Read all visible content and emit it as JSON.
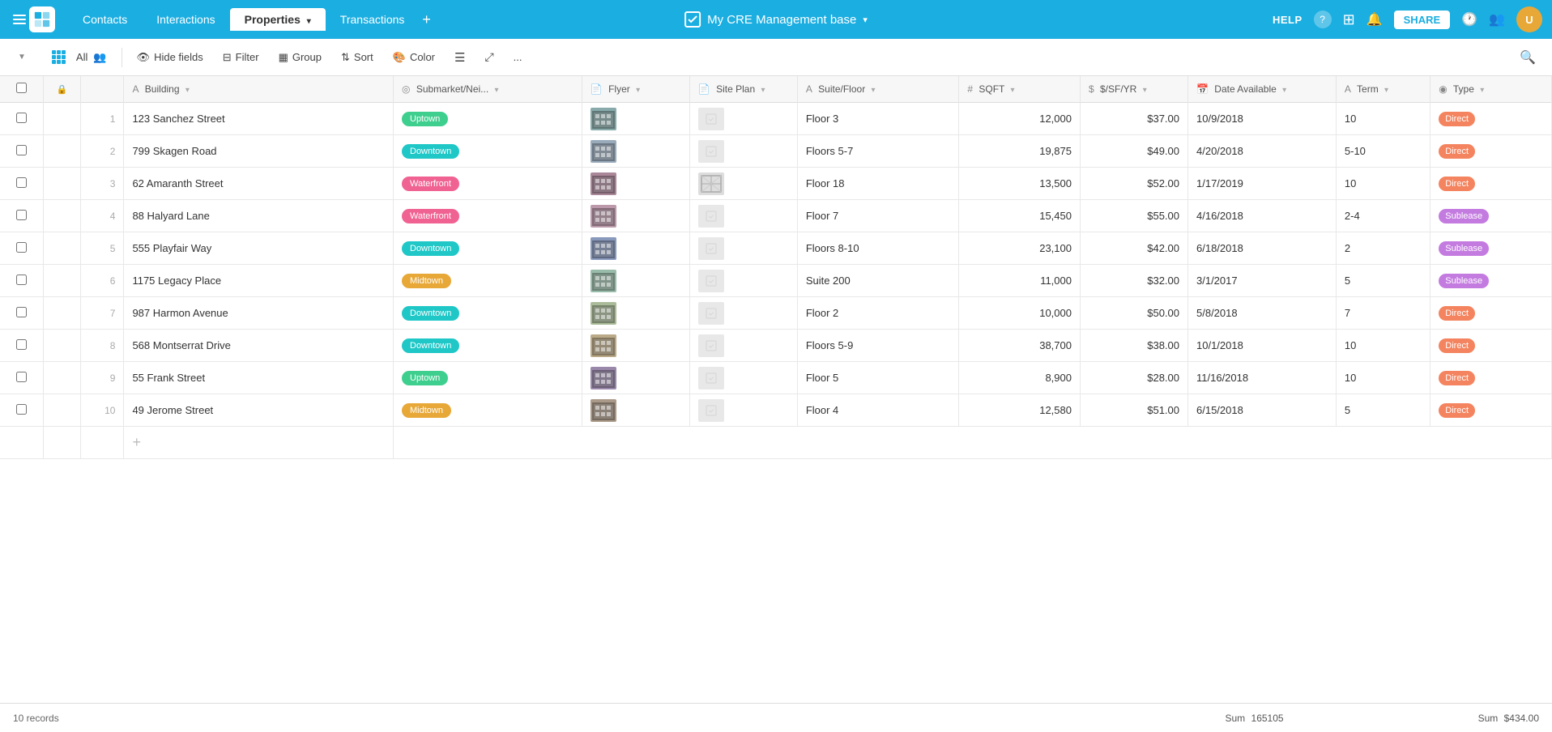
{
  "app": {
    "logo_alt": "Airtable",
    "base_title": "My CRE Management base",
    "dropdown_arrow": "▼"
  },
  "nav": {
    "tabs": [
      {
        "label": "Contacts",
        "active": false
      },
      {
        "label": "Interactions",
        "active": false
      },
      {
        "label": "Properties",
        "active": true,
        "has_dropdown": true
      },
      {
        "label": "Transactions",
        "active": false
      }
    ],
    "add_tab": "+",
    "right": {
      "help": "HELP",
      "share": "SHARE"
    }
  },
  "toolbar": {
    "view_all": "All",
    "hide_fields": "Hide fields",
    "filter": "Filter",
    "group": "Group",
    "sort": "Sort",
    "color": "Color",
    "more": "..."
  },
  "table": {
    "columns": [
      {
        "id": "building",
        "label": "Building",
        "type": "text",
        "icon": "A"
      },
      {
        "id": "submarket",
        "label": "Submarket/Nei...",
        "type": "location",
        "icon": "◎"
      },
      {
        "id": "flyer",
        "label": "Flyer",
        "type": "attachment",
        "icon": "📄"
      },
      {
        "id": "siteplan",
        "label": "Site Plan",
        "type": "attachment",
        "icon": "📄"
      },
      {
        "id": "suite",
        "label": "Suite/Floor",
        "type": "text",
        "icon": "A"
      },
      {
        "id": "sqft",
        "label": "SQFT",
        "type": "number",
        "icon": "#"
      },
      {
        "id": "price",
        "label": "$/SF/YR",
        "type": "currency",
        "icon": "$"
      },
      {
        "id": "date",
        "label": "Date Available",
        "type": "date",
        "icon": "📅"
      },
      {
        "id": "term",
        "label": "Term",
        "type": "text",
        "icon": "A"
      },
      {
        "id": "type",
        "label": "Type",
        "type": "select",
        "icon": "◉"
      }
    ],
    "rows": [
      {
        "num": 1,
        "building": "123 Sanchez Street",
        "submarket": "Uptown",
        "submarket_color": "uptown",
        "flyer_has": true,
        "siteplan_has": false,
        "suite": "Floor 3",
        "sqft": 12000,
        "price": "$37.00",
        "date": "10/9/2018",
        "term": "10",
        "type": "Direct",
        "type_color": "direct"
      },
      {
        "num": 2,
        "building": "799 Skagen Road",
        "submarket": "Downtown",
        "submarket_color": "downtown",
        "flyer_has": true,
        "siteplan_has": false,
        "suite": "Floors 5-7",
        "sqft": 19875,
        "price": "$49.00",
        "date": "4/20/2018",
        "term": "5-10",
        "type": "Direct",
        "type_color": "direct"
      },
      {
        "num": 3,
        "building": "62 Amaranth Street",
        "submarket": "Waterfront",
        "submarket_color": "waterfront",
        "flyer_has": true,
        "siteplan_has": true,
        "suite": "Floor 18",
        "sqft": 13500,
        "price": "$52.00",
        "date": "1/17/2019",
        "term": "10",
        "type": "Direct",
        "type_color": "direct"
      },
      {
        "num": 4,
        "building": "88 Halyard Lane",
        "submarket": "Waterfront",
        "submarket_color": "waterfront",
        "flyer_has": true,
        "siteplan_has": false,
        "suite": "Floor 7",
        "sqft": 15450,
        "price": "$55.00",
        "date": "4/16/2018",
        "term": "2-4",
        "type": "Sublease",
        "type_color": "sublease"
      },
      {
        "num": 5,
        "building": "555 Playfair Way",
        "submarket": "Downtown",
        "submarket_color": "downtown",
        "flyer_has": true,
        "siteplan_has": false,
        "suite": "Floors 8-10",
        "sqft": 23100,
        "price": "$42.00",
        "date": "6/18/2018",
        "term": "2",
        "type": "Sublease",
        "type_color": "sublease"
      },
      {
        "num": 6,
        "building": "1175 Legacy Place",
        "submarket": "Midtown",
        "submarket_color": "midtown",
        "flyer_has": true,
        "siteplan_has": false,
        "suite": "Suite 200",
        "sqft": 11000,
        "price": "$32.00",
        "date": "3/1/2017",
        "term": "5",
        "type": "Sublease",
        "type_color": "sublease"
      },
      {
        "num": 7,
        "building": "987 Harmon Avenue",
        "submarket": "Downtown",
        "submarket_color": "downtown",
        "flyer_has": true,
        "siteplan_has": false,
        "suite": "Floor 2",
        "sqft": 10000,
        "price": "$50.00",
        "date": "5/8/2018",
        "term": "7",
        "type": "Direct",
        "type_color": "direct"
      },
      {
        "num": 8,
        "building": "568 Montserrat Drive",
        "submarket": "Downtown",
        "submarket_color": "downtown",
        "flyer_has": true,
        "siteplan_has": false,
        "suite": "Floors 5-9",
        "sqft": 38700,
        "price": "$38.00",
        "date": "10/1/2018",
        "term": "10",
        "type": "Direct",
        "type_color": "direct"
      },
      {
        "num": 9,
        "building": "55 Frank Street",
        "submarket": "Uptown",
        "submarket_color": "uptown",
        "flyer_has": true,
        "siteplan_has": false,
        "suite": "Floor 5",
        "sqft": 8900,
        "price": "$28.00",
        "date": "11/16/2018",
        "term": "10",
        "type": "Direct",
        "type_color": "direct"
      },
      {
        "num": 10,
        "building": "49 Jerome Street",
        "submarket": "Midtown",
        "submarket_color": "midtown",
        "flyer_has": true,
        "siteplan_has": false,
        "suite": "Floor 4",
        "sqft": 12580,
        "price": "$51.00",
        "date": "6/15/2018",
        "term": "5",
        "type": "Direct",
        "type_color": "direct"
      }
    ]
  },
  "status": {
    "records": "10 records",
    "sqft_sum_label": "Sum",
    "sqft_sum": "165105",
    "price_sum_label": "Sum",
    "price_sum": "$434.00"
  }
}
